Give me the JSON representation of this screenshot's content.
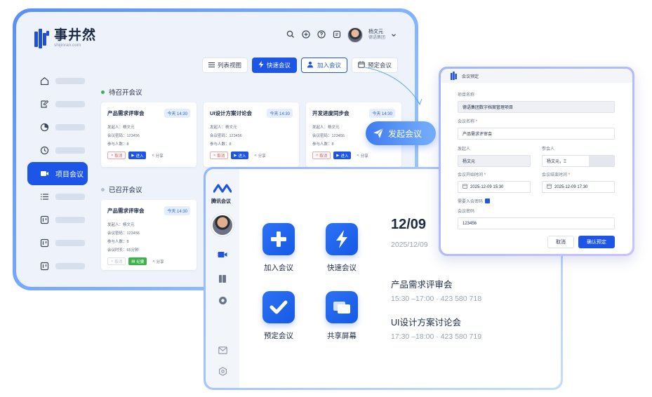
{
  "brand": {
    "name": "事井然",
    "domain": "shijinran.com",
    "accent": "#1d55e6"
  },
  "user": {
    "name": "杨文元",
    "org": "德语集团"
  },
  "sidebar": {
    "active_label": "项目会议"
  },
  "toolbar": {
    "list_view": "列表视图",
    "quick_meeting": "快速会议",
    "join_meeting": "加入会议",
    "book_meeting": "预定会议"
  },
  "upcoming": {
    "title": "待召开会议",
    "cards": [
      {
        "title": "产品需求评审会",
        "time": "今天 14:30",
        "initiator": "发起人：杨文元",
        "password": "会议密码：123456",
        "participants": "参与人数：8",
        "cancel": "取消",
        "join": "进入",
        "share": "分享"
      },
      {
        "title": "UI设计方案讨论会",
        "time": "今天 14:30",
        "initiator": "发起人：杨文元",
        "password": "会议密码：123456",
        "participants": "参与人数：8",
        "cancel": "取消",
        "join": "进入",
        "share": "分享"
      },
      {
        "title": "开发进度同步会",
        "time": "今天 14:30",
        "initiator": "发起人：杨文元",
        "password": "会议密码：123456",
        "participants": "参与人数：8",
        "cancel": "取消",
        "join": "进入",
        "share": "分享"
      }
    ]
  },
  "past": {
    "title": "已召开会议",
    "card": {
      "title": "产品需求评审会",
      "time": "今天 14:30",
      "initiator": "发起人：杨文元",
      "password": "会议密码：123456",
      "participants": "参与人数：8",
      "duration": "会议时长：65分钟",
      "cancel": "取消",
      "minutes": "纪要",
      "share": "分享"
    }
  },
  "launch": {
    "label": "发起会议"
  },
  "tencent": {
    "app_name": "腾讯会议",
    "actions": {
      "join": "加入会议",
      "quick": "快速会议",
      "book": "预定会议",
      "share_screen": "共享屏幕"
    },
    "date": "12/09",
    "date_sub": "2025/12/09",
    "meetings": [
      {
        "title": "产品需求评审会",
        "detail": "15:30 –17:00  ·  423 580 718"
      },
      {
        "title": "UI设计方案讨论会",
        "detail": "17:30 –18:00  ·  423 580 719"
      }
    ]
  },
  "booking": {
    "title": "会议预定",
    "project_label": "项目名称",
    "project_value": "德语集团数字档案管理项目",
    "meeting_name_label": "会议名称",
    "meeting_name_value": "产品需求评审会",
    "initiator_label": "发起人",
    "initiator_value": "杨文元",
    "participants_label": "参会人",
    "participants_value": "杨文元，Ξ",
    "start_label": "会议开始时间",
    "start_value": "2025-12-09 15:30",
    "end_label": "会议结束时间",
    "end_value": "2025-12-09 17:30",
    "password_toggle_label": "需要入会密码",
    "password_label": "会议密码",
    "password_value": "123456",
    "cancel": "取消",
    "confirm": "确认预定"
  }
}
